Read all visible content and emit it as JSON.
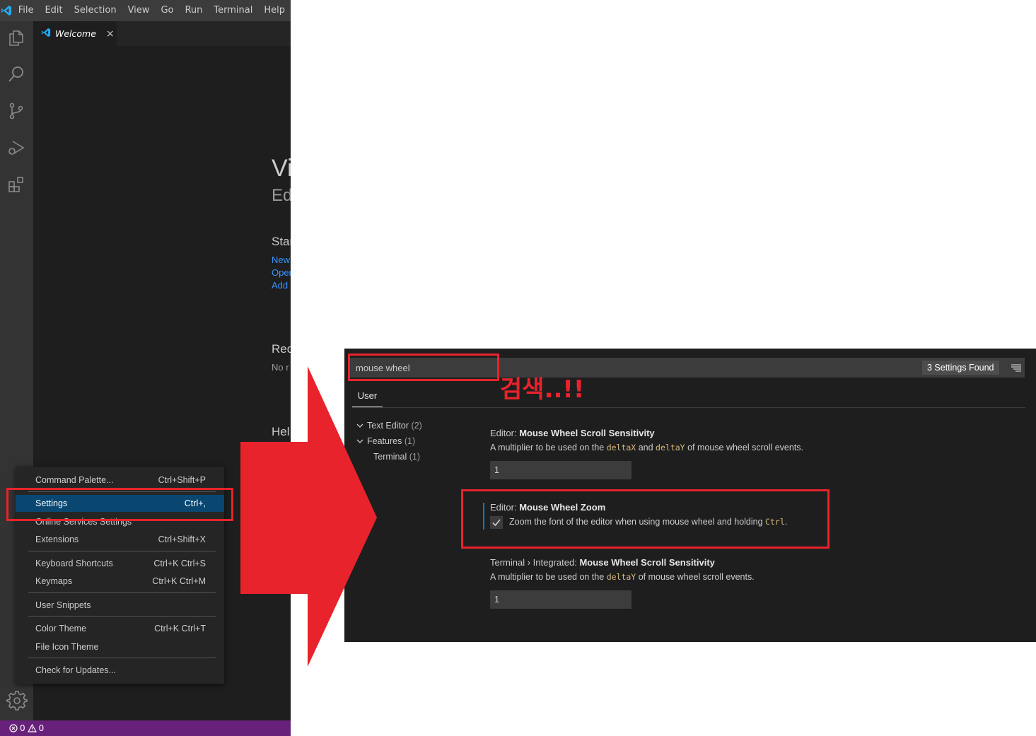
{
  "window": {
    "menu": [
      "File",
      "Edit",
      "Selection",
      "View",
      "Go",
      "Run",
      "Terminal",
      "Help"
    ],
    "tab": {
      "label": "Welcome",
      "close": "×"
    },
    "welcome": {
      "title_frag": "Vi",
      "subtitle_frag": "Ed",
      "start_frag": "Star",
      "links": [
        "New",
        "Oper",
        "Add"
      ],
      "recent_frag": "Rec",
      "recent_empty_frag": "No r",
      "help_frag": "Hel"
    },
    "status": {
      "errors": "0",
      "warnings": "0"
    }
  },
  "context_menu": {
    "items": [
      {
        "label": "Command Palette...",
        "shortcut": "Ctrl+Shift+P"
      },
      {
        "label": "Settings",
        "shortcut": "Ctrl+,"
      },
      {
        "label": "Online Services Settings",
        "shortcut": ""
      },
      {
        "label": "Extensions",
        "shortcut": "Ctrl+Shift+X"
      },
      {
        "label": "Keyboard Shortcuts",
        "shortcut": "Ctrl+K Ctrl+S"
      },
      {
        "label": "Keymaps",
        "shortcut": "Ctrl+K Ctrl+M"
      },
      {
        "label": "User Snippets",
        "shortcut": ""
      },
      {
        "label": "Color Theme",
        "shortcut": "Ctrl+K Ctrl+T"
      },
      {
        "label": "File Icon Theme",
        "shortcut": ""
      },
      {
        "label": "Check for Updates...",
        "shortcut": ""
      }
    ]
  },
  "settings": {
    "search_value": "mouse wheel",
    "found": "3 Settings Found",
    "tab": "User",
    "toc": [
      {
        "label": "Text Editor",
        "count": "(2)"
      },
      {
        "label": "Features",
        "count": "(1)"
      },
      {
        "label": "Terminal",
        "count": "(1)"
      }
    ],
    "scroll": {
      "prefix": "Editor: ",
      "title": "Mouse Wheel Scroll Sensitivity",
      "desc_a": "A multiplier to be used on the ",
      "code_1": "deltaX",
      "desc_b": " and ",
      "code_2": "deltaY",
      "desc_c": " of mouse wheel scroll events.",
      "value": "1"
    },
    "zoom": {
      "prefix": "Editor: ",
      "title": "Mouse Wheel Zoom",
      "desc_a": "Zoom the font of the editor when using mouse wheel and holding ",
      "code": "Ctrl",
      "desc_b": ".",
      "checked": true
    },
    "terminal": {
      "prefix": "Terminal › Integrated: ",
      "title": "Mouse Wheel Scroll Sensitivity",
      "desc_a": "A multiplier to be used on the ",
      "code": "deltaY",
      "desc_b": " of mouse wheel scroll events.",
      "value": "1"
    }
  },
  "annotation": {
    "text": "검색..!!"
  },
  "colors": {
    "accent_red": "#e8232b",
    "status_bar": "#68217a",
    "menu_selection": "#094771",
    "focus_blue": "#007fd4",
    "link_blue": "#3794ff"
  }
}
